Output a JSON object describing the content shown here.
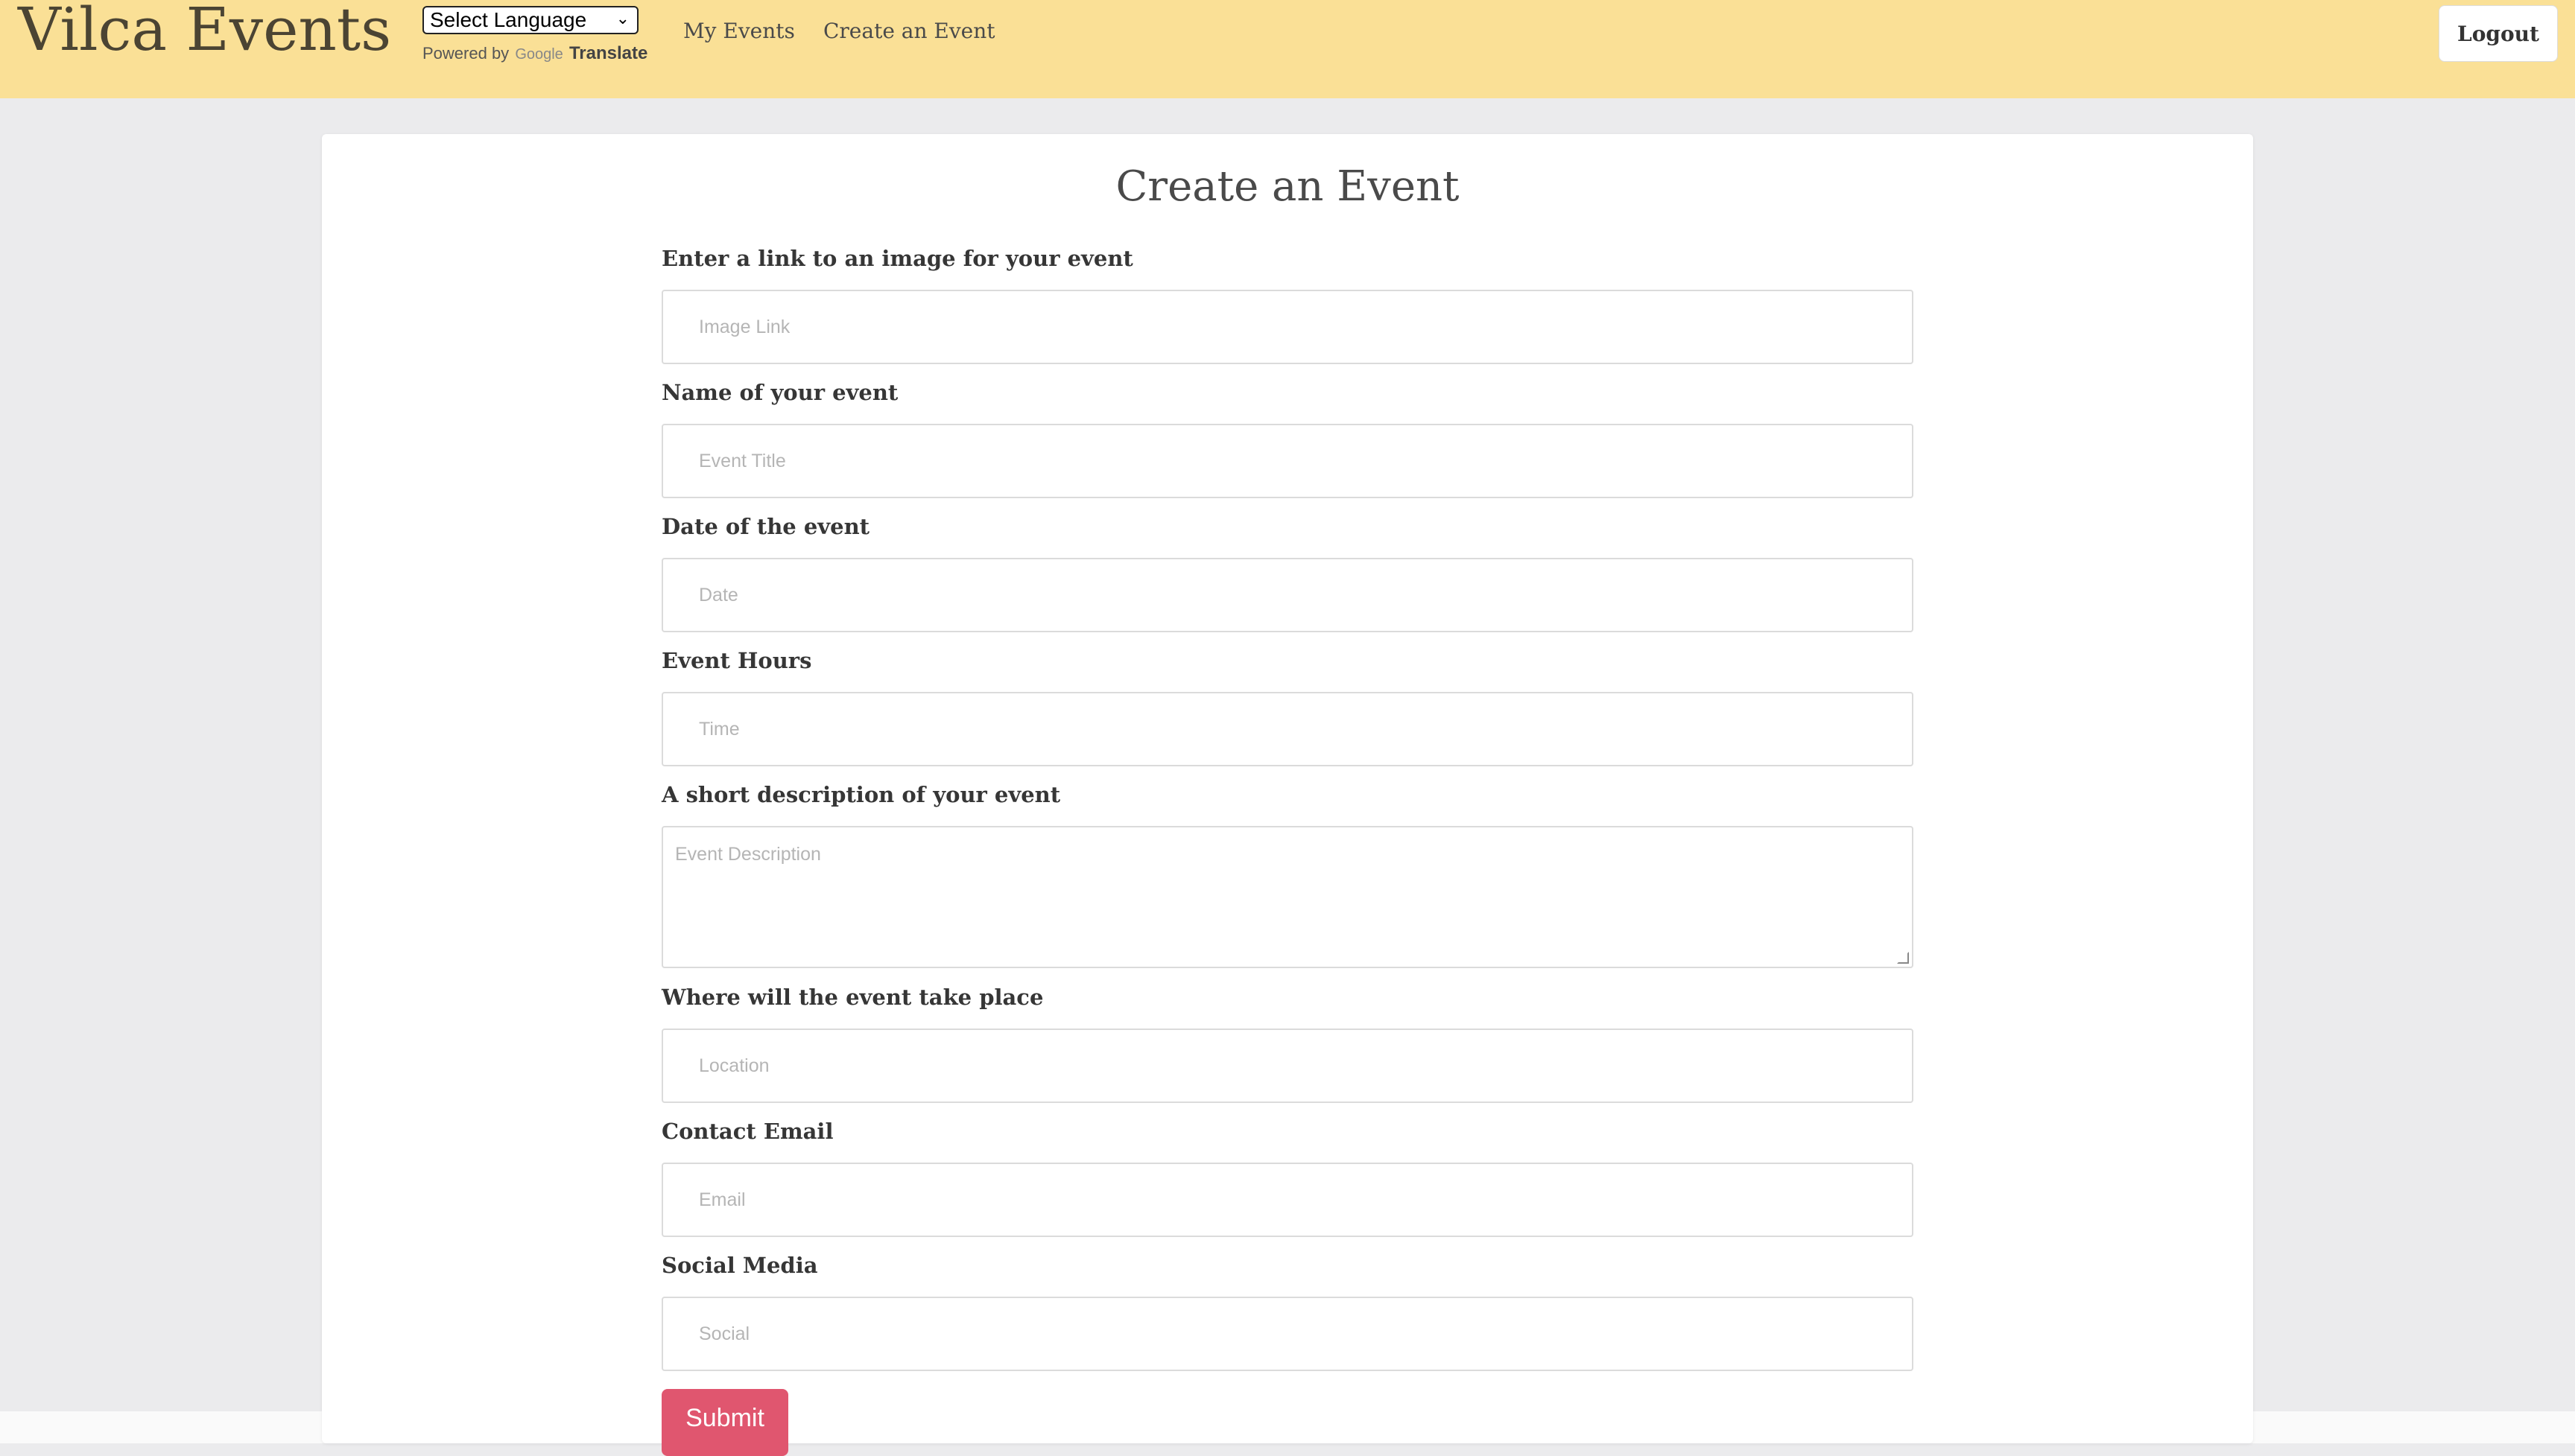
{
  "header": {
    "brand": "Vilca Events",
    "language_select": "Select Language",
    "powered_by": "Powered by",
    "google": "Google",
    "translate": "Translate",
    "nav": [
      "My Events",
      "Create an Event"
    ],
    "logout": "Logout"
  },
  "form": {
    "title": "Create an Event",
    "fields": [
      {
        "label": "Enter a link to an image for your event",
        "placeholder": "Image Link"
      },
      {
        "label": "Name of your event",
        "placeholder": "Event Title"
      },
      {
        "label": "Date of the event",
        "placeholder": "Date"
      },
      {
        "label": "Event Hours",
        "placeholder": "Time"
      },
      {
        "label": "A short description of your event",
        "placeholder": "Event Description"
      },
      {
        "label": "Where will the event take place",
        "placeholder": "Location"
      },
      {
        "label": "Contact Email",
        "placeholder": "Email"
      },
      {
        "label": "Social Media",
        "placeholder": "Social"
      }
    ],
    "submit": "Submit"
  },
  "colors": {
    "header_bg": "#fae096",
    "page_bg": "#ebebed",
    "submit_bg": "#e0566f"
  }
}
